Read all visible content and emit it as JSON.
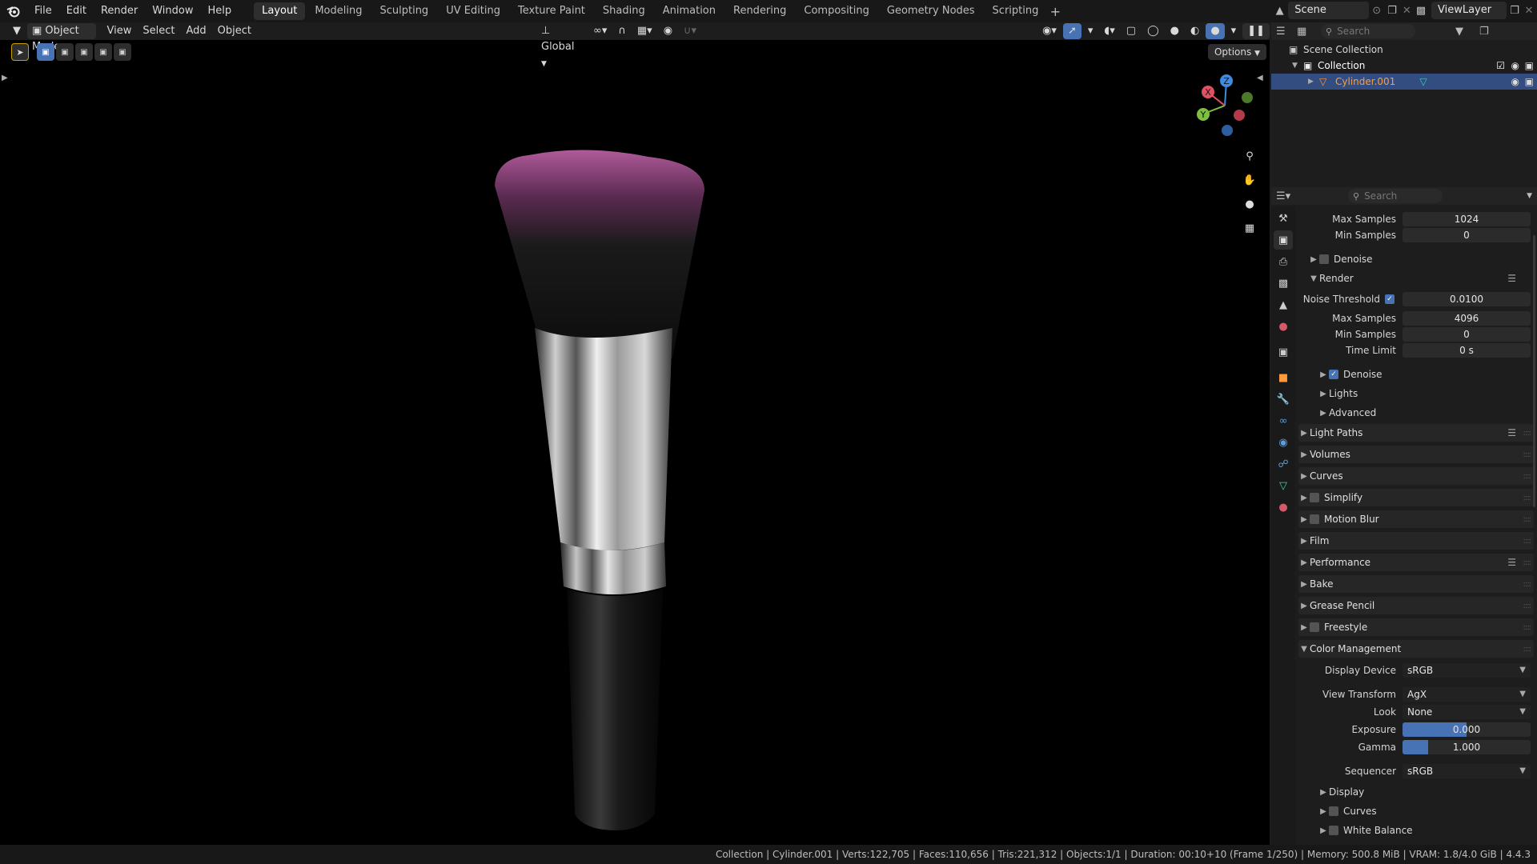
{
  "topbar": {
    "menus": [
      "File",
      "Edit",
      "Render",
      "Window",
      "Help"
    ],
    "workspaces": [
      "Layout",
      "Modeling",
      "Sculpting",
      "UV Editing",
      "Texture Paint",
      "Shading",
      "Animation",
      "Rendering",
      "Compositing",
      "Geometry Nodes",
      "Scripting"
    ],
    "active_workspace": "Layout",
    "add_tab": "+",
    "scene": "Scene",
    "view_layer": "ViewLayer"
  },
  "viewport": {
    "mode": "Object Mode",
    "menus": [
      "View",
      "Select",
      "Add",
      "Object"
    ],
    "orientation": "Global",
    "options": "Options",
    "gizmo": {
      "z": "Z",
      "y": "Y",
      "x": "X"
    }
  },
  "outliner": {
    "search_placeholder": "Search",
    "scene_collection": "Scene Collection",
    "collection": "Collection",
    "object": "Cylinder.001"
  },
  "properties": {
    "search_placeholder": "Search",
    "viewport_max_samples_label": "Max Samples",
    "viewport_max_samples": "1024",
    "viewport_min_samples_label": "Min Samples",
    "viewport_min_samples": "0",
    "viewport_denoise": "Denoise",
    "render_panel": "Render",
    "noise_threshold_label": "Noise Threshold",
    "noise_threshold": "0.0100",
    "render_max_samples_label": "Max Samples",
    "render_max_samples": "4096",
    "render_min_samples_label": "Min Samples",
    "render_min_samples": "0",
    "time_limit_label": "Time Limit",
    "time_limit": "0 s",
    "render_denoise": "Denoise",
    "lights": "Lights",
    "advanced": "Advanced",
    "panels": {
      "light_paths": "Light Paths",
      "volumes": "Volumes",
      "curves": "Curves",
      "simplify": "Simplify",
      "motion_blur": "Motion Blur",
      "film": "Film",
      "performance": "Performance",
      "bake": "Bake",
      "grease_pencil": "Grease Pencil",
      "freestyle": "Freestyle",
      "color_management": "Color Management"
    },
    "color_management": {
      "display_device_label": "Display Device",
      "display_device": "sRGB",
      "view_transform_label": "View Transform",
      "view_transform": "AgX",
      "look_label": "Look",
      "look": "None",
      "exposure_label": "Exposure",
      "exposure": "0.000",
      "exposure_fill": 0.5,
      "gamma_label": "Gamma",
      "gamma": "1.000",
      "gamma_fill": 0.2,
      "sequencer_label": "Sequencer",
      "sequencer": "sRGB",
      "display": "Display",
      "curves": "Curves",
      "white_balance": "White Balance"
    }
  },
  "statusbar": {
    "text": "Collection | Cylinder.001 | Verts:122,705 | Faces:110,656 | Tris:221,312 | Objects:1/1 | Duration: 00:10+10 (Frame 1/250) | Memory: 500.8 MiB | VRAM: 1.8/4.0 GiB | 4.4.3"
  },
  "colors": {
    "accent": "#4772b3",
    "selection": "#334d80",
    "object_name": "#ff9b3b",
    "gizmo_x": "#e05263",
    "gizmo_y": "#7fbf3f",
    "gizmo_z": "#3f8be0"
  }
}
